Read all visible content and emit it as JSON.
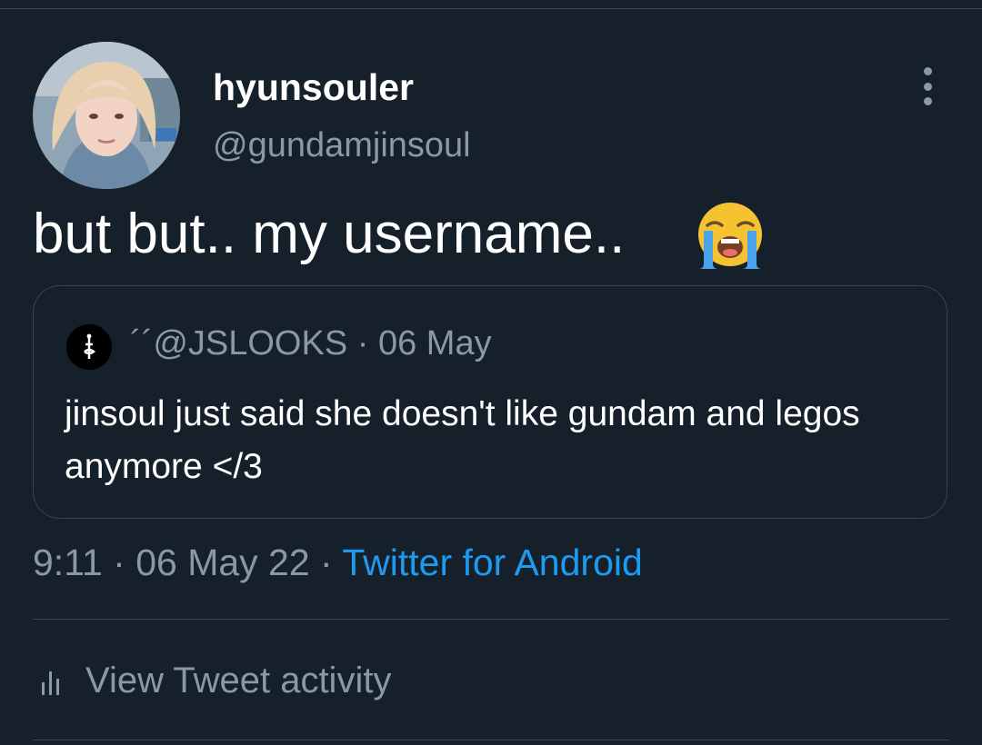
{
  "tweet": {
    "display_name": "hyunsouler",
    "handle": "@gundamjinsoul",
    "text": "but but.. my username..",
    "emoji": "loudly-crying-face-icon",
    "time": "9:11",
    "date": "06 May 22",
    "source": "Twitter for Android"
  },
  "quoted_tweet": {
    "author_mark": "´´",
    "handle": "@JSLOOKS",
    "date": "06 May",
    "text": "jinsoul just said she doesn't like gundam and legos anymore </3"
  },
  "activity": {
    "label": "View Tweet activity",
    "icon": "bar-chart-icon"
  },
  "colors": {
    "background": "#15202b",
    "border": "#38444d",
    "secondary_text": "#8b98a5",
    "accent": "#1d9bf0"
  }
}
